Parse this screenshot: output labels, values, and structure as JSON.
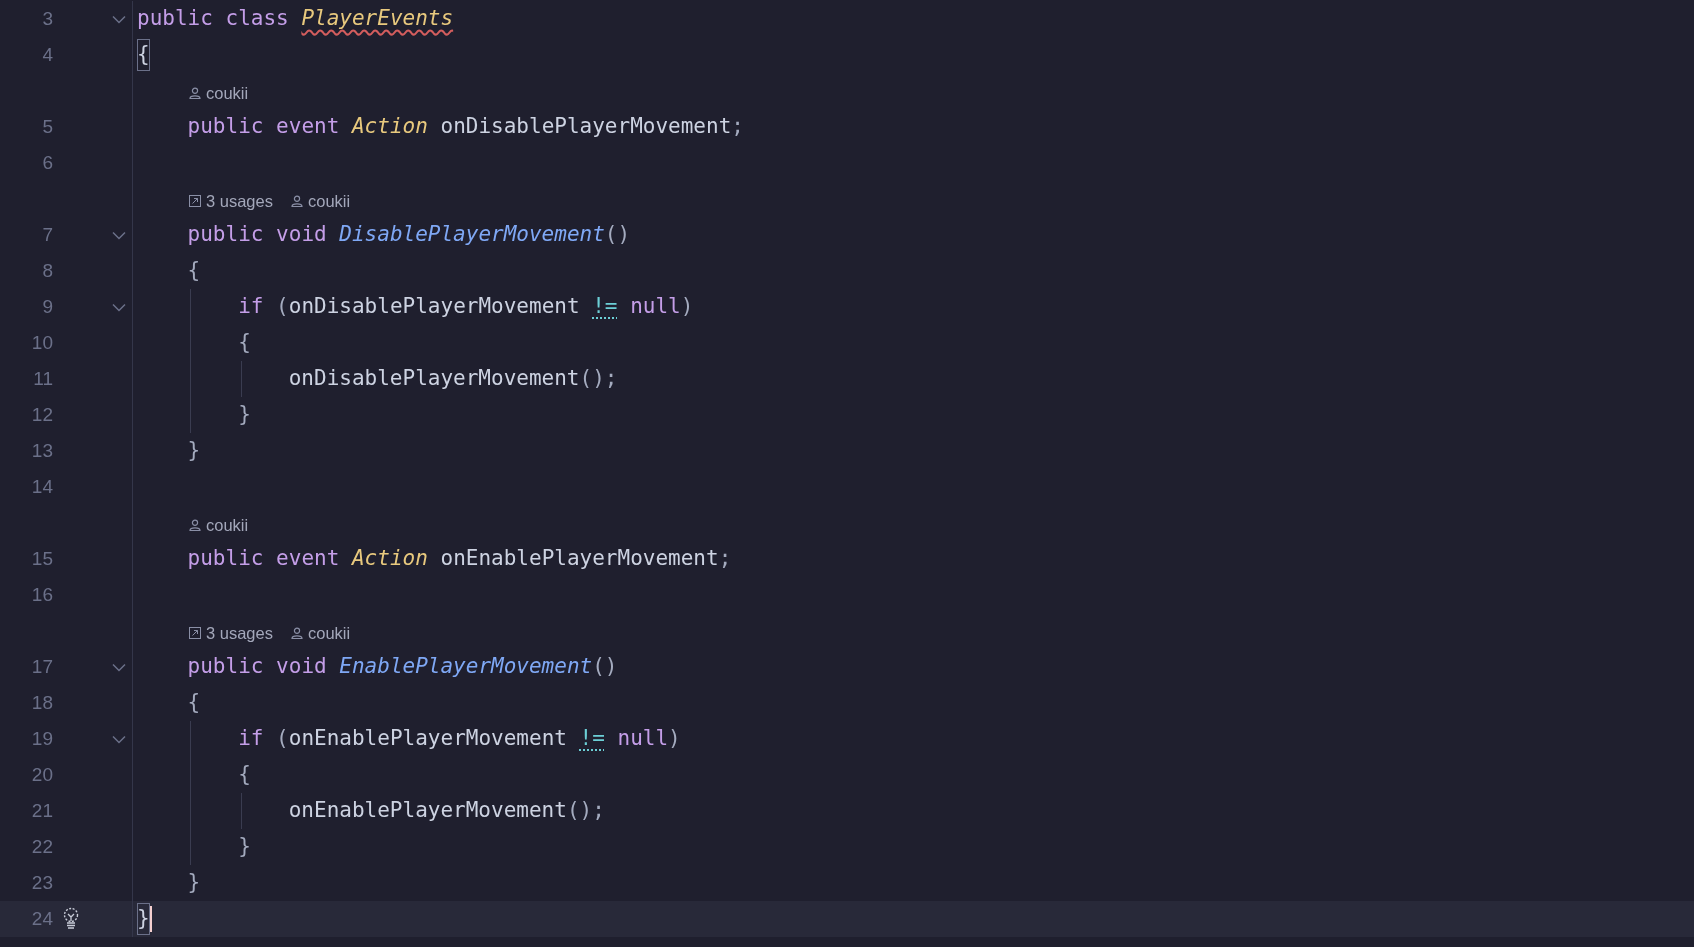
{
  "editor": {
    "rows": [
      {
        "kind": "code",
        "number": "3",
        "foldable": true,
        "current": false,
        "bulb": false,
        "tokens": [
          {
            "kind": "keyword",
            "text": "public "
          },
          {
            "kind": "keyword",
            "text": "class "
          },
          {
            "kind": "class-name",
            "text": "PlayerEvents"
          }
        ]
      },
      {
        "kind": "code",
        "number": "4",
        "foldable": false,
        "current": false,
        "bulb": false,
        "tokens": [
          {
            "kind": "brace-match",
            "text": "{"
          }
        ]
      },
      {
        "kind": "hint",
        "items": [
          {
            "kind": "author",
            "text": "coukii"
          }
        ]
      },
      {
        "kind": "code",
        "number": "5",
        "foldable": false,
        "current": false,
        "bulb": false,
        "tokens": [
          {
            "kind": "keyword",
            "text": "    public "
          },
          {
            "kind": "keyword",
            "text": "event "
          },
          {
            "kind": "type",
            "text": "Action "
          },
          {
            "kind": "ident",
            "text": "onDisablePlayerMovement"
          },
          {
            "kind": "punct",
            "text": ";"
          }
        ]
      },
      {
        "kind": "code",
        "number": "6",
        "foldable": false,
        "current": false,
        "bulb": false
      },
      {
        "kind": "hint",
        "items": [
          {
            "kind": "usages",
            "text": "3 usages"
          },
          {
            "kind": "author",
            "text": "coukii"
          }
        ]
      },
      {
        "kind": "code",
        "number": "7",
        "foldable": true,
        "current": false,
        "bulb": false,
        "tokens": [
          {
            "kind": "keyword",
            "text": "    public "
          },
          {
            "kind": "keyword",
            "text": "void "
          },
          {
            "kind": "method",
            "text": "DisablePlayerMovement"
          },
          {
            "kind": "punct",
            "text": "()"
          }
        ]
      },
      {
        "kind": "code",
        "number": "8",
        "foldable": false,
        "current": false,
        "bulb": false,
        "tokens": [
          {
            "kind": "punct",
            "text": "    {"
          }
        ]
      },
      {
        "kind": "code",
        "number": "9",
        "foldable": true,
        "current": false,
        "bulb": false,
        "tokens": [
          {
            "kind": "keyword",
            "text": "        if "
          },
          {
            "kind": "punct",
            "text": "("
          },
          {
            "kind": "ident",
            "text": "onDisablePlayerMovement "
          },
          {
            "kind": "operator",
            "text": "!="
          },
          {
            "kind": "keyword",
            "text": " null"
          },
          {
            "kind": "punct",
            "text": ")"
          }
        ]
      },
      {
        "kind": "code",
        "number": "10",
        "foldable": false,
        "current": false,
        "bulb": false,
        "tokens": [
          {
            "kind": "punct",
            "text": "        {"
          }
        ]
      },
      {
        "kind": "code",
        "number": "11",
        "foldable": false,
        "current": false,
        "bulb": false,
        "tokens": [
          {
            "kind": "ident",
            "text": "            onDisablePlayerMovement"
          },
          {
            "kind": "punct",
            "text": "();"
          }
        ]
      },
      {
        "kind": "code",
        "number": "12",
        "foldable": false,
        "current": false,
        "bulb": false,
        "tokens": [
          {
            "kind": "punct",
            "text": "        }"
          }
        ]
      },
      {
        "kind": "code",
        "number": "13",
        "foldable": false,
        "current": false,
        "bulb": false,
        "tokens": [
          {
            "kind": "punct",
            "text": "    }"
          }
        ]
      },
      {
        "kind": "code",
        "number": "14",
        "foldable": false,
        "current": false,
        "bulb": false
      },
      {
        "kind": "hint",
        "items": [
          {
            "kind": "author",
            "text": "coukii"
          }
        ]
      },
      {
        "kind": "code",
        "number": "15",
        "foldable": false,
        "current": false,
        "bulb": false,
        "tokens": [
          {
            "kind": "keyword",
            "text": "    public "
          },
          {
            "kind": "keyword",
            "text": "event "
          },
          {
            "kind": "type",
            "text": "Action "
          },
          {
            "kind": "ident",
            "text": "onEnablePlayerMovement"
          },
          {
            "kind": "punct",
            "text": ";"
          }
        ]
      },
      {
        "kind": "code",
        "number": "16",
        "foldable": false,
        "current": false,
        "bulb": false
      },
      {
        "kind": "hint",
        "items": [
          {
            "kind": "usages",
            "text": "3 usages"
          },
          {
            "kind": "author",
            "text": "coukii"
          }
        ]
      },
      {
        "kind": "code",
        "number": "17",
        "foldable": true,
        "current": false,
        "bulb": false,
        "tokens": [
          {
            "kind": "keyword",
            "text": "    public "
          },
          {
            "kind": "keyword",
            "text": "void "
          },
          {
            "kind": "method",
            "text": "EnablePlayerMovement"
          },
          {
            "kind": "punct",
            "text": "()"
          }
        ]
      },
      {
        "kind": "code",
        "number": "18",
        "foldable": false,
        "current": false,
        "bulb": false,
        "tokens": [
          {
            "kind": "punct",
            "text": "    {"
          }
        ]
      },
      {
        "kind": "code",
        "number": "19",
        "foldable": true,
        "current": false,
        "bulb": false,
        "tokens": [
          {
            "kind": "keyword",
            "text": "        if "
          },
          {
            "kind": "punct",
            "text": "("
          },
          {
            "kind": "ident",
            "text": "onEnablePlayerMovement "
          },
          {
            "kind": "operator",
            "text": "!="
          },
          {
            "kind": "keyword",
            "text": " null"
          },
          {
            "kind": "punct",
            "text": ")"
          }
        ]
      },
      {
        "kind": "code",
        "number": "20",
        "foldable": false,
        "current": false,
        "bulb": false,
        "tokens": [
          {
            "kind": "punct",
            "text": "        {"
          }
        ]
      },
      {
        "kind": "code",
        "number": "21",
        "foldable": false,
        "current": false,
        "bulb": false,
        "tokens": [
          {
            "kind": "ident",
            "text": "            onEnablePlayerMovement"
          },
          {
            "kind": "punct",
            "text": "();"
          }
        ]
      },
      {
        "kind": "code",
        "number": "22",
        "foldable": false,
        "current": false,
        "bulb": false,
        "tokens": [
          {
            "kind": "punct",
            "text": "        }"
          }
        ]
      },
      {
        "kind": "code",
        "number": "23",
        "foldable": false,
        "current": false,
        "bulb": false,
        "tokens": [
          {
            "kind": "punct",
            "text": "    }"
          }
        ]
      },
      {
        "kind": "code",
        "number": "24",
        "foldable": false,
        "current": true,
        "bulb": true,
        "tokens": [
          {
            "kind": "brace-match",
            "text": "}"
          }
        ]
      }
    ]
  }
}
